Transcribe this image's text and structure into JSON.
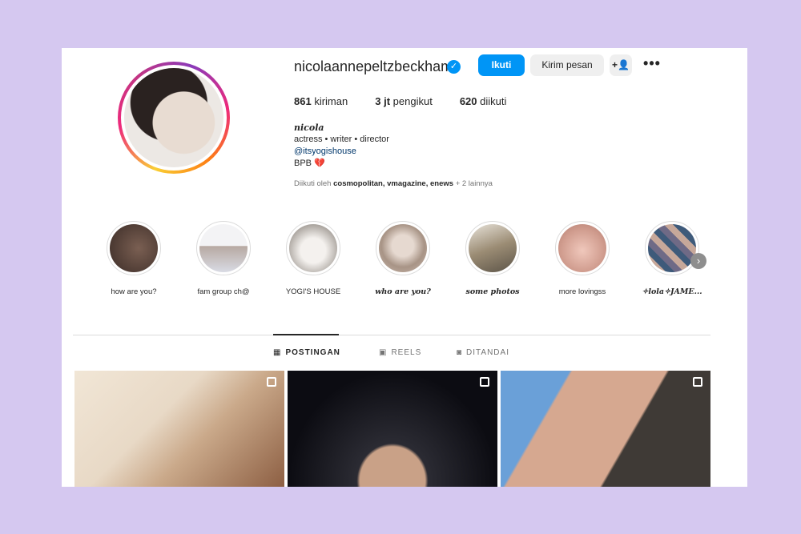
{
  "profile": {
    "username": "nicolaannepeltzbeckham",
    "verified_mark": "✓",
    "buttons": {
      "follow": "Ikuti",
      "message": "Kirim pesan",
      "add_user": "+👤",
      "more": "•••"
    },
    "stats": [
      {
        "value": "861",
        "label": "kiriman"
      },
      {
        "value": "3 jt",
        "label": "pengikut"
      },
      {
        "value": "620",
        "label": "diikuti"
      }
    ],
    "bio": {
      "name": "𝒏𝒊𝒄𝒐𝒍𝒂",
      "line1": "actress • writer • director",
      "link": "@itsyogishouse",
      "line3": "BPB",
      "heart": "💔"
    },
    "followed_by": {
      "prefix": "Diikuti oleh",
      "names": "cosmopolitan, vmagazine, enews",
      "suffix": "+ 2 lainnya"
    }
  },
  "highlights": [
    {
      "label": "how are you?",
      "color": "#4a3a33"
    },
    {
      "label": "fam group ch@",
      "color": "#cfd6e0"
    },
    {
      "label": "YOGI'S HOUSE",
      "color": "#d9d4ce"
    },
    {
      "label": "𝒘𝒉𝒐 𝒂𝒓𝒆 𝒚𝒐𝒖?",
      "color": "#b9a596"
    },
    {
      "label": "𝒔𝒐𝒎𝒆 𝒑𝒉𝒐𝒕𝒐𝒔",
      "color": "#9a8a70"
    },
    {
      "label": "more lovingss",
      "color": "#d9b4a8"
    },
    {
      "label": "✧𝒍𝒐𝒍𝒂✧JAME...",
      "color": "#8c7d86"
    }
  ],
  "tabs": [
    {
      "icon": "▦",
      "label": "POSTINGAN"
    },
    {
      "icon": "▣",
      "label": "REELS"
    },
    {
      "icon": "◙",
      "label": "DITANDAI"
    }
  ],
  "highlight_next": "›"
}
